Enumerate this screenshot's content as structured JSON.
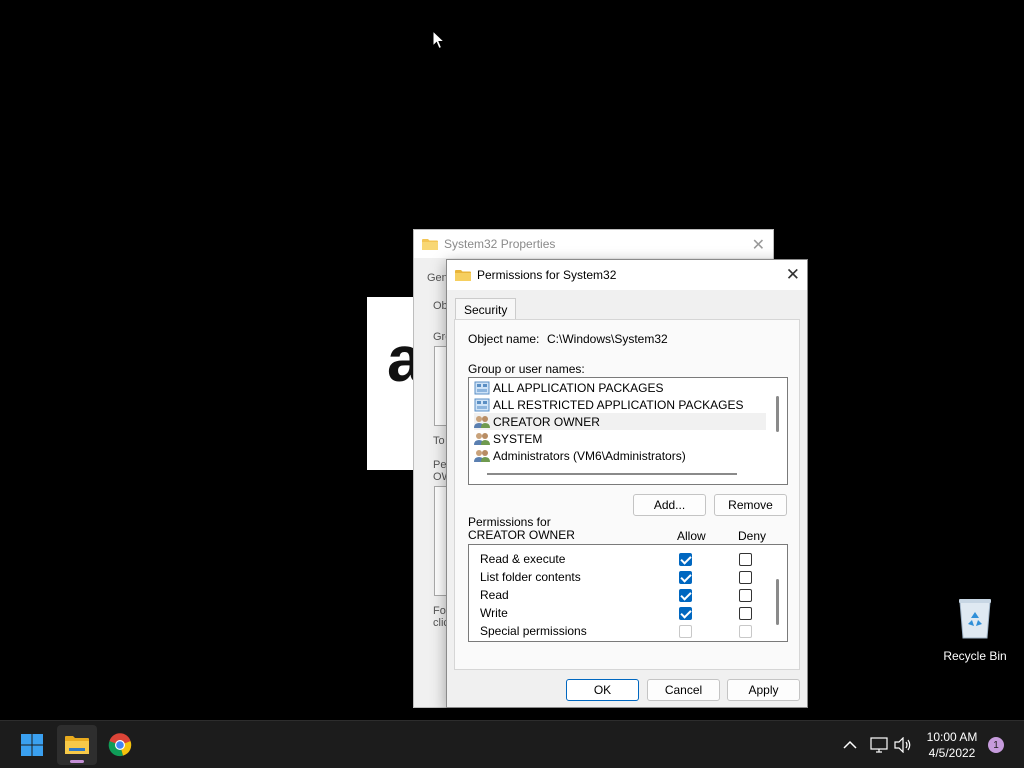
{
  "props_dialog": {
    "title": "System32 Properties",
    "fragments": [
      "Gen",
      "Ob",
      "Gro",
      "To",
      "Pe",
      "OW",
      "For",
      "clic"
    ]
  },
  "background_app": {
    "letter": "a"
  },
  "permissions_dialog": {
    "title": "Permissions for System32",
    "tab": "Security",
    "object_name_label": "Object name:",
    "object_name_value": "C:\\Windows\\System32",
    "group_label": "Group or user names:",
    "users": [
      {
        "name": "ALL APPLICATION PACKAGES",
        "icon": "package-group-icon",
        "selected": false
      },
      {
        "name": "ALL RESTRICTED APPLICATION PACKAGES",
        "icon": "package-group-icon",
        "selected": false
      },
      {
        "name": "CREATOR OWNER",
        "icon": "user-group-icon",
        "selected": true
      },
      {
        "name": "SYSTEM",
        "icon": "user-group-icon",
        "selected": false
      },
      {
        "name": "Administrators (VM6\\Administrators)",
        "icon": "user-group-icon",
        "selected": false
      }
    ],
    "add_label": "Add...",
    "remove_label": "Remove",
    "permissions_for_label": "Permissions for CREATOR OWNER",
    "allow_header": "Allow",
    "deny_header": "Deny",
    "permissions": [
      {
        "name": "Read & execute",
        "allow": true,
        "deny": false,
        "disabled": false
      },
      {
        "name": "List folder contents",
        "allow": true,
        "deny": false,
        "disabled": false
      },
      {
        "name": "Read",
        "allow": true,
        "deny": false,
        "disabled": false
      },
      {
        "name": "Write",
        "allow": true,
        "deny": false,
        "disabled": false
      },
      {
        "name": "Special permissions",
        "allow": false,
        "deny": false,
        "disabled": true
      }
    ],
    "ok_label": "OK",
    "cancel_label": "Cancel",
    "apply_label": "Apply"
  },
  "desktop": {
    "recycle_bin_label": "Recycle Bin"
  },
  "taskbar": {
    "apps": [
      "start-icon",
      "file-explorer-icon",
      "chrome-icon"
    ],
    "time": "10:00 AM",
    "date": "4/5/2022",
    "notification_count": "1"
  },
  "colors": {
    "accent": "#0067c0",
    "taskbar": "#1c1c1c",
    "desktop": "#000000"
  }
}
